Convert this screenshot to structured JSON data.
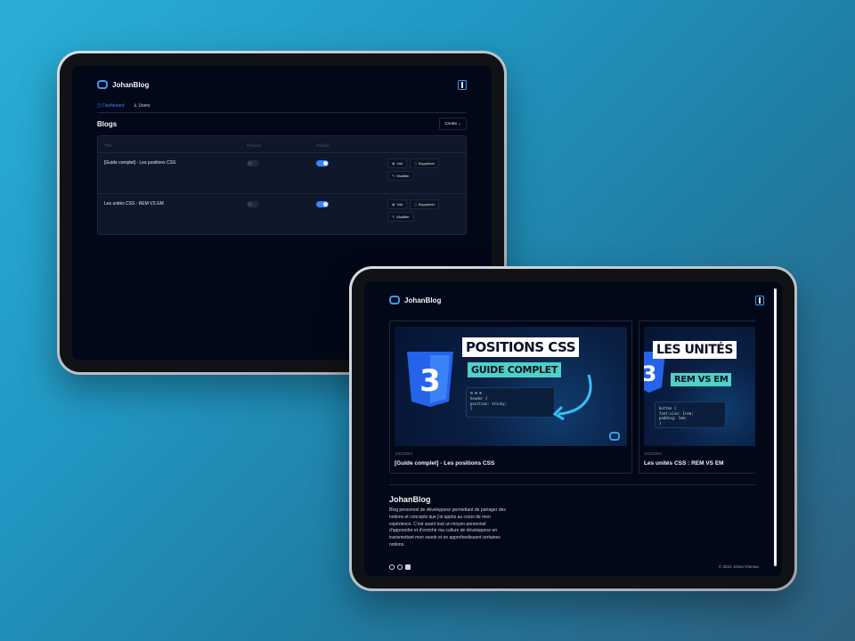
{
  "dashboard": {
    "brand": "JohanBlog",
    "nav": {
      "dashboard": "Dashboard",
      "users": "Users"
    },
    "section_title": "Blogs",
    "create_label": "Create",
    "columns": {
      "title": "Title",
      "preview": "Preview",
      "publish": "Publish"
    },
    "rows": [
      {
        "title": "[Guide complet] - Les positions CSS",
        "preview": false,
        "publish": true
      },
      {
        "title": "Les unités CSS : REM VS EM",
        "preview": false,
        "publish": true
      }
    ],
    "actions": {
      "view": "Voir",
      "delete": "Supprimer",
      "edit": "Modifier"
    }
  },
  "blog": {
    "brand": "JohanBlog",
    "cards": [
      {
        "thumb_title": "POSITIONS CSS",
        "thumb_sub": "GUIDE COMPLET",
        "code": [
          "header {",
          "  position: sticky;",
          "}"
        ],
        "date": "1/22/2024",
        "title": "[Guide complet] - Les positions CSS"
      },
      {
        "thumb_title": "LES UNITÉS",
        "thumb_sub": "REM VS EM",
        "code": [
          "button {",
          "  font-size: 1rem;",
          "  padding: 1em;",
          "}"
        ],
        "date": "1/22/2024",
        "title": "Les unités CSS : REM VS EM"
      }
    ],
    "footer": {
      "brand": "JohanBlog",
      "description": "Blog personnel de développeur permettant de partager des notions et concepts que j'ai appris au cours de mon expérience. C'est avant tout un moyen personnel d'apprendre et d'enrichir ma culture de développeur en transmettant mon savoir et en approfondissant certaines notions.",
      "copyright": "© 2024 Johan Chenau"
    }
  },
  "colors": {
    "accent": "#3b82f6",
    "screen_bg": "#020817",
    "teal": "#4fd1c5"
  }
}
